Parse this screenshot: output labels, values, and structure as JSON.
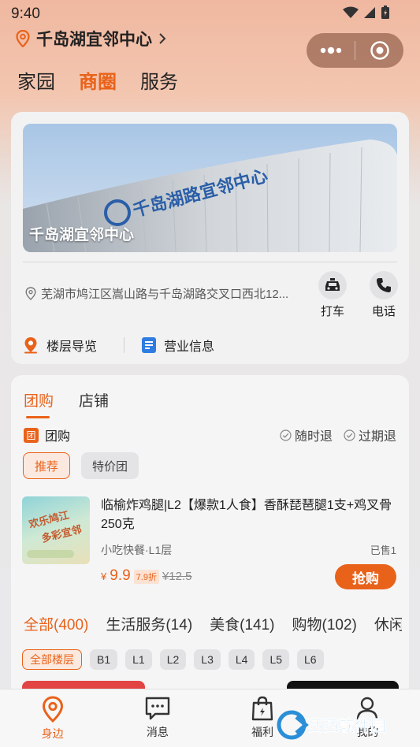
{
  "status_bar": {
    "time": "9:40"
  },
  "header": {
    "location_name": "千岛湖宜邻中心"
  },
  "top_tabs": [
    {
      "label": "家园",
      "active": false
    },
    {
      "label": "商圈",
      "active": true
    },
    {
      "label": "服务",
      "active": false
    }
  ],
  "store": {
    "banner_caption": "千岛湖宜邻中心",
    "banner_sign": "千岛湖路宜邻中心",
    "address": "芜湖市鸠江区嵩山路与千岛湖路交叉口西北12...",
    "actions": [
      {
        "label": "打车",
        "icon": "taxi-icon"
      },
      {
        "label": "电话",
        "icon": "phone-icon"
      }
    ],
    "links": [
      {
        "label": "楼层导览",
        "icon": "floor-guide-icon"
      },
      {
        "label": "营业信息",
        "icon": "business-info-icon"
      }
    ]
  },
  "section_tabs": [
    {
      "label": "团购",
      "active": true
    },
    {
      "label": "店铺",
      "active": false
    }
  ],
  "group_buy": {
    "badge": "团",
    "title": "团购",
    "tags": [
      "随时退",
      "过期退"
    ],
    "filters": [
      {
        "label": "推荐",
        "active": true
      },
      {
        "label": "特价团",
        "active": false
      }
    ]
  },
  "product": {
    "title": "临榆炸鸡腿|L2【爆款1人食】香酥琵琶腿1支+鸡叉骨250克",
    "category": "小吃快餐·L1层",
    "sold": "已售1",
    "currency": "¥",
    "price": "9.9",
    "discount": "7.9折",
    "original_price": "¥12.5",
    "buy_label": "抢购",
    "thumb_text_1": "欢乐鸠江",
    "thumb_text_2": "多彩宜邻"
  },
  "category_tabs": [
    {
      "label": "全部(400)",
      "active": true
    },
    {
      "label": "生活服务(14)",
      "active": false
    },
    {
      "label": "美食(141)",
      "active": false
    },
    {
      "label": "购物(102)",
      "active": false
    },
    {
      "label": "休闲",
      "active": false
    }
  ],
  "floor_filters": [
    {
      "label": "全部楼层",
      "active": true
    },
    {
      "label": "B1",
      "active": false
    },
    {
      "label": "L1",
      "active": false
    },
    {
      "label": "L2",
      "active": false
    },
    {
      "label": "L3",
      "active": false
    },
    {
      "label": "L4",
      "active": false
    },
    {
      "label": "L5",
      "active": false
    },
    {
      "label": "L6",
      "active": false
    }
  ],
  "bottom_nav": [
    {
      "label": "身边",
      "icon": "location-pin-icon",
      "active": true
    },
    {
      "label": "消息",
      "icon": "message-icon",
      "active": false
    },
    {
      "label": "福利",
      "icon": "gift-bag-icon",
      "active": false
    },
    {
      "label": "我的",
      "icon": "user-icon",
      "active": false
    }
  ],
  "watermark": "西西软件园",
  "colors": {
    "accent": "#e9621a"
  }
}
